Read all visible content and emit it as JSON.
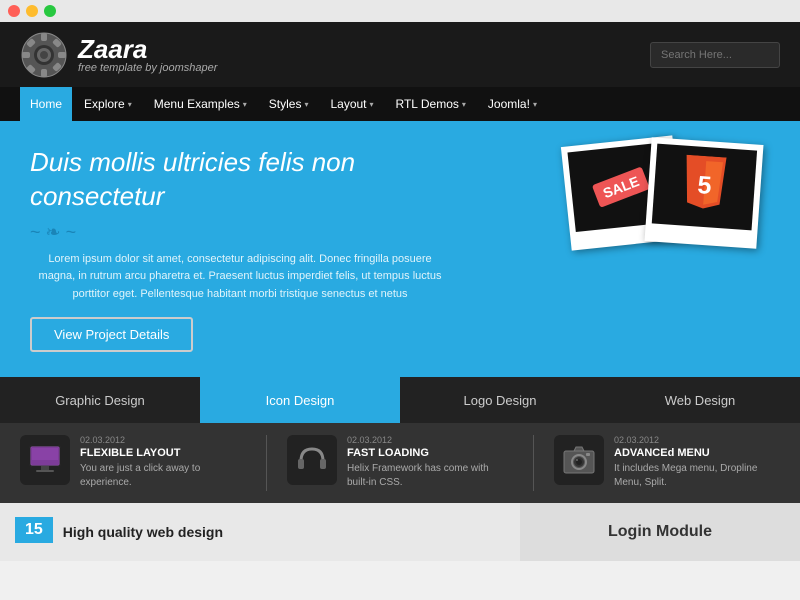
{
  "titlebar": {
    "btn_red": "close",
    "btn_yellow": "minimize",
    "btn_green": "maximize"
  },
  "header": {
    "logo_name": "Zaara",
    "logo_tagline": "free template by joomshaper",
    "search_placeholder": "Search Here..."
  },
  "navbar": {
    "items": [
      {
        "label": "Home",
        "active": true,
        "has_arrow": false
      },
      {
        "label": "Explore",
        "active": false,
        "has_arrow": true
      },
      {
        "label": "Menu Examples",
        "active": false,
        "has_arrow": true
      },
      {
        "label": "Styles",
        "active": false,
        "has_arrow": true
      },
      {
        "label": "Layout",
        "active": false,
        "has_arrow": true
      },
      {
        "label": "RTL Demos",
        "active": false,
        "has_arrow": true
      },
      {
        "label": "Joomla!",
        "active": false,
        "has_arrow": true
      }
    ]
  },
  "hero": {
    "title": "Duis mollis ultricies felis non consectetur",
    "divider_ornament": "~ ❧ ~",
    "description": "Lorem ipsum dolor sit amet, consectetur adipiscing alit. Donec fringilla posuere magna, in\nrutrum arcu pharetra et. Praesent luctus imperdiet felis, ut tempus luctus porttitor eget.\nPellentesque habitant morbi tristique senectus et netus",
    "btn_label": "View Project Details",
    "polaroid1_label": "SALE",
    "polaroid2_label": "5"
  },
  "tabs": {
    "items": [
      {
        "label": "Graphic Design",
        "active": false
      },
      {
        "label": "Icon Design",
        "active": true
      },
      {
        "label": "Logo Design",
        "active": false
      },
      {
        "label": "Web Design",
        "active": false
      }
    ]
  },
  "features": [
    {
      "date": "02.03.2012",
      "title": "FLEXIBLE LAYOUT",
      "description": "You are just a click away to experience.",
      "icon": "monitor-icon"
    },
    {
      "date": "02.03.2012",
      "title": "FAST LOADING",
      "description": "Helix Framework has come with built-in CSS.",
      "icon": "headphones-icon"
    },
    {
      "date": "02.03.2012",
      "title": "ADVANCEd MENU",
      "description": "It includes Mega menu, Dropline Menu, Split.",
      "icon": "camera-icon"
    }
  ],
  "bottom": {
    "badge_number": "15",
    "section_title": "High quality web design",
    "login_module_label": "Login Module"
  }
}
